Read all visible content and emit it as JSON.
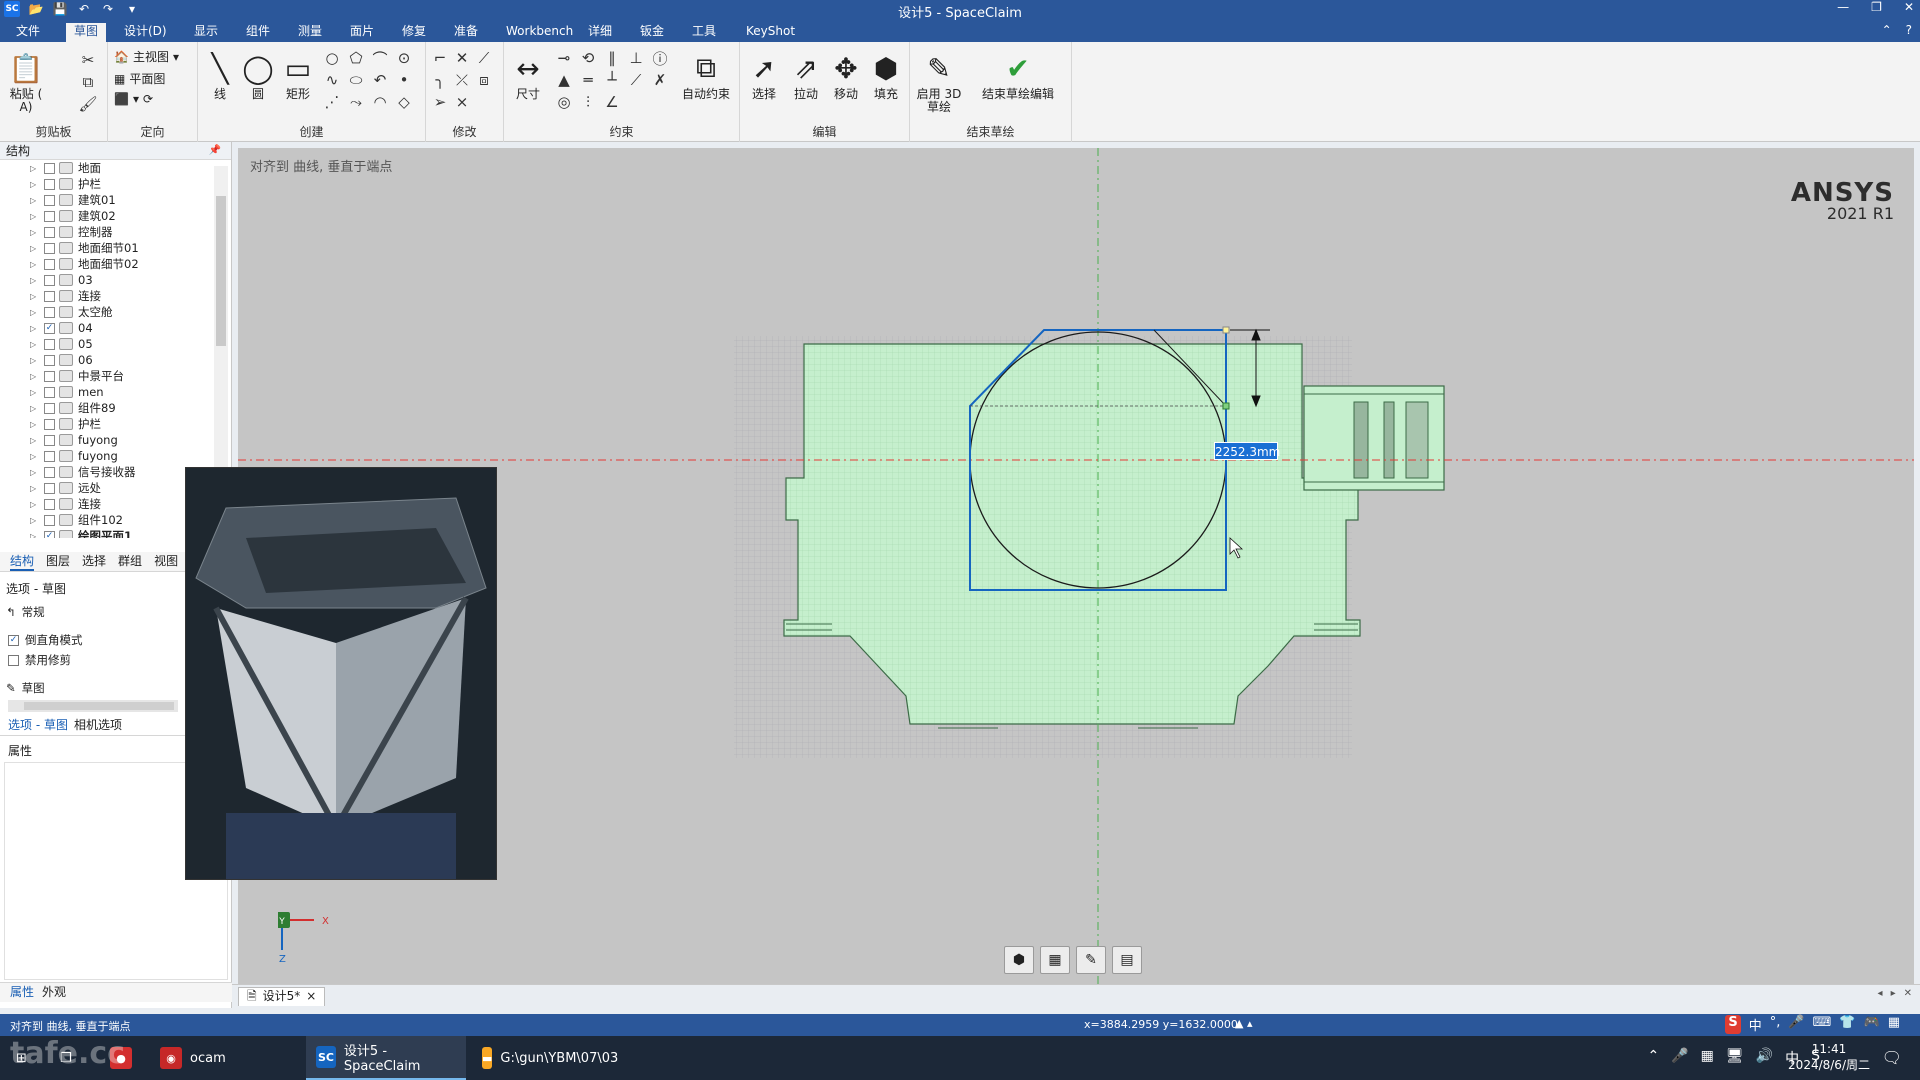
{
  "window": {
    "title": "设计5 - SpaceClaim",
    "logo_text": "SC",
    "qat_icons": [
      "open-icon",
      "save-icon",
      "undo-icon",
      "redo-icon",
      "customize-icon"
    ],
    "controls": [
      "minimize-icon",
      "restore-icon",
      "close-icon"
    ]
  },
  "menu": {
    "tabs": [
      "文件",
      "草图",
      "设计(D)",
      "显示",
      "组件",
      "测量",
      "面片",
      "修复",
      "准备",
      "Workbench",
      "详细",
      "钣金",
      "工具",
      "KeyShot"
    ],
    "active_tab": "草图"
  },
  "ribbon": {
    "groups": {
      "clipboard": "剪贴板",
      "orient": "定向",
      "create": "创建",
      "modify": "修改",
      "constraint": "约束",
      "edit": "编辑",
      "end_sketch": "结束草绘"
    },
    "clipboard": {
      "paste": "粘贴 ( A)"
    },
    "orient": {
      "home_view": "主视图",
      "plan_view": "平面图"
    },
    "create": {
      "line": "线",
      "circle": "圆",
      "rectangle": "矩形"
    },
    "constraint": {
      "dimension": "尺寸",
      "auto_constrain": "自动约束"
    },
    "edit": {
      "select": "选择",
      "pull": "拉动",
      "move": "移动",
      "fill": "填充"
    },
    "end_sketch": {
      "enable_3d": "启用 3D 草绘",
      "finish": "结束草绘编辑"
    }
  },
  "left_panel": {
    "header": "结构",
    "tree": [
      {
        "label": "地面",
        "checked": false
      },
      {
        "label": "护栏",
        "checked": false
      },
      {
        "label": "建筑01",
        "checked": false
      },
      {
        "label": "建筑02",
        "checked": false
      },
      {
        "label": "控制器",
        "checked": false
      },
      {
        "label": "地面细节01",
        "checked": false
      },
      {
        "label": "地面细节02",
        "checked": false
      },
      {
        "label": "03",
        "checked": false
      },
      {
        "label": "连接",
        "checked": false
      },
      {
        "label": "太空舱",
        "checked": false
      },
      {
        "label": "04",
        "checked": true
      },
      {
        "label": "05",
        "checked": false
      },
      {
        "label": "06",
        "checked": false
      },
      {
        "label": "中景平台",
        "checked": false
      },
      {
        "label": "men",
        "checked": false
      },
      {
        "label": "组件89",
        "checked": false
      },
      {
        "label": "护栏",
        "checked": false
      },
      {
        "label": "fuyong",
        "checked": false
      },
      {
        "label": "fuyong",
        "checked": false
      },
      {
        "label": "信号接收器",
        "checked": false
      },
      {
        "label": "远处",
        "checked": false
      },
      {
        "label": "连接",
        "checked": false
      },
      {
        "label": "组件102",
        "checked": false
      },
      {
        "label": "绘图平面1",
        "checked": true
      }
    ],
    "tabs": [
      "结构",
      "图层",
      "选择",
      "群组",
      "视图"
    ],
    "options_title": "选项 - 草图",
    "section_normal": "常规",
    "chk_chamfer": {
      "label": "倒直角模式",
      "checked": true
    },
    "chk_trim": {
      "label": "禁用修剪",
      "checked": false
    },
    "section_sketch": "草图",
    "option_tabs": [
      "选项 - 草图",
      "相机选项"
    ],
    "props_title": "属性",
    "bottom_tabs": [
      "属性",
      "外观"
    ]
  },
  "viewport": {
    "snap_hint": "对齐到 曲线, 垂直于端点",
    "logo_brand": "ANSYS",
    "logo_version": "2021 R1",
    "dimension_value": "2252.3mm",
    "triad": {
      "y": "Y",
      "x": "X",
      "z": "Z"
    },
    "view_tools": [
      "solid-view-icon",
      "sketch-grid-icon",
      "sketch-plane-icon",
      "section-mode-icon"
    ],
    "colors": {
      "part_fill": "#c5efcd",
      "grid_bg": "#b7b7bd",
      "sketch_line": "#1565c0"
    }
  },
  "doc_tab": {
    "label": "设计5*",
    "close": "×"
  },
  "statusbar": {
    "text": "对齐到 曲线, 垂直于端点",
    "coords": "x=3884.2959  y=1632.0000"
  },
  "taskbar": {
    "tasks": [
      {
        "label": "ocam"
      },
      {
        "label": "设计5 - SpaceClaim"
      },
      {
        "label": "G:\\gun\\YBM\\07\\03"
      }
    ],
    "time": "11:41",
    "date": "2024/8/6/周二",
    "ime_lang": "中",
    "tray_lang": "中",
    "watermark": "tafe.cc"
  }
}
